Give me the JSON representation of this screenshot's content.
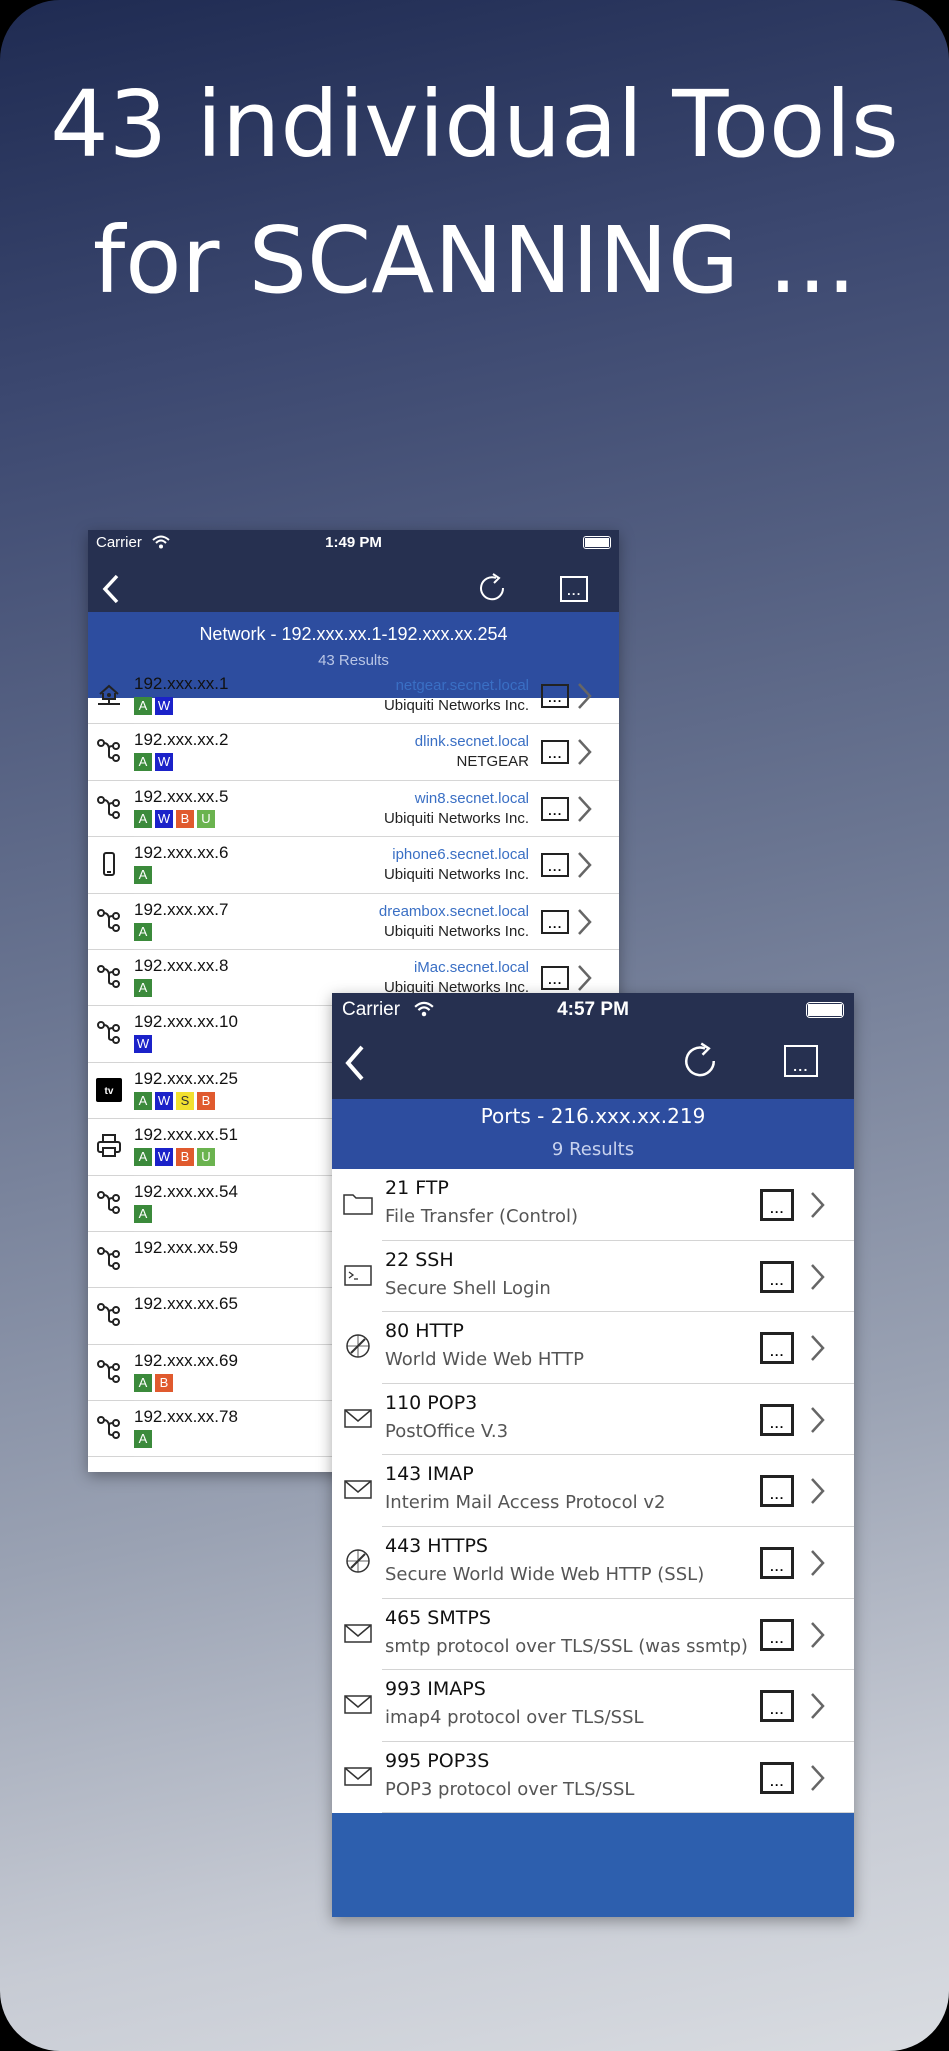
{
  "headline": {
    "line1": "43 individual Tools",
    "line2": "for SCANNING ..."
  },
  "network_screen": {
    "status": {
      "carrier": "Carrier",
      "time": "1:49 PM"
    },
    "banner": {
      "title": "Network - 192.xxx.xx.1-192.xxx.xx.254",
      "results": "43 Results"
    },
    "rows": [
      {
        "icon": "router-home-icon",
        "ip": "192.xxx.xx.1",
        "badges": [
          "A",
          "W"
        ],
        "host": "netgear.secnet.local",
        "vendor": "Ubiquiti Networks Inc."
      },
      {
        "icon": "network-node-icon",
        "ip": "192.xxx.xx.2",
        "badges": [
          "A",
          "W"
        ],
        "host": "dlink.secnet.local",
        "vendor": "NETGEAR"
      },
      {
        "icon": "network-node-icon",
        "ip": "192.xxx.xx.5",
        "badges": [
          "A",
          "W",
          "B",
          "U"
        ],
        "host": "win8.secnet.local",
        "vendor": "Ubiquiti Networks Inc."
      },
      {
        "icon": "phone-icon",
        "ip": "192.xxx.xx.6",
        "badges": [
          "A"
        ],
        "host": "iphone6.secnet.local",
        "vendor": "Ubiquiti Networks Inc."
      },
      {
        "icon": "network-node-icon",
        "ip": "192.xxx.xx.7",
        "badges": [
          "A"
        ],
        "host": "dreambox.secnet.local",
        "vendor": "Ubiquiti Networks Inc."
      },
      {
        "icon": "network-node-icon",
        "ip": "192.xxx.xx.8",
        "badges": [
          "A"
        ],
        "host": "iMac.secnet.local",
        "vendor": "Ubiquiti Networks Inc."
      },
      {
        "icon": "network-node-icon",
        "ip": "192.xxx.xx.10",
        "badges": [
          "W"
        ],
        "host": "",
        "vendor": ""
      },
      {
        "icon": "tv-icon",
        "ip": "192.xxx.xx.25",
        "badges": [
          "A",
          "W",
          "S",
          "B"
        ],
        "host": "",
        "vendor": ""
      },
      {
        "icon": "printer-icon",
        "ip": "192.xxx.xx.51",
        "badges": [
          "A",
          "W",
          "B",
          "U"
        ],
        "host": "",
        "vendor": ""
      },
      {
        "icon": "network-node-icon",
        "ip": "192.xxx.xx.54",
        "badges": [
          "A"
        ],
        "host": "",
        "vendor": ""
      },
      {
        "icon": "network-node-icon",
        "ip": "192.xxx.xx.59",
        "badges": [],
        "host": "",
        "vendor": ""
      },
      {
        "icon": "network-node-icon",
        "ip": "192.xxx.xx.65",
        "badges": [],
        "host": "",
        "vendor": ""
      },
      {
        "icon": "network-node-icon",
        "ip": "192.xxx.xx.69",
        "badges": [
          "A",
          "B"
        ],
        "host": "",
        "vendor": ""
      },
      {
        "icon": "network-node-icon",
        "ip": "192.xxx.xx.78",
        "badges": [
          "A"
        ],
        "host": "",
        "vendor": ""
      }
    ]
  },
  "ports_screen": {
    "status": {
      "carrier": "Carrier",
      "time": "4:57 PM"
    },
    "banner": {
      "title": "Ports - 216.xxx.xx.219",
      "results": "9 Results"
    },
    "rows": [
      {
        "icon": "folder-icon",
        "port": "21 FTP",
        "desc": "File Transfer (Control)"
      },
      {
        "icon": "terminal-icon",
        "port": "22 SSH",
        "desc": "Secure Shell Login"
      },
      {
        "icon": "compass-icon",
        "port": "80 HTTP",
        "desc": "World Wide Web HTTP"
      },
      {
        "icon": "mail-icon",
        "port": "110 POP3",
        "desc": "PostOffice V.3"
      },
      {
        "icon": "mail-icon",
        "port": "143 IMAP",
        "desc": "Interim Mail Access Protocol v2"
      },
      {
        "icon": "compass-icon",
        "port": "443 HTTPS",
        "desc": "Secure World Wide Web HTTP (SSL)"
      },
      {
        "icon": "mail-icon",
        "port": "465 SMTPS",
        "desc": "smtp protocol over TLS/SSL (was ssmtp)"
      },
      {
        "icon": "mail-icon",
        "port": "993 IMAPS",
        "desc": "imap4 protocol over TLS/SSL"
      },
      {
        "icon": "mail-icon",
        "port": "995 POP3S",
        "desc": "POP3 protocol over TLS/SSL"
      }
    ]
  },
  "colors": {
    "navbar": "#263050",
    "banner": "#2d4d9f",
    "link": "#3a6fc4",
    "badge_A": "#3b8a3b",
    "badge_W": "#1b22c9",
    "badge_B": "#e05a2e",
    "badge_U": "#6bb34f",
    "badge_S": "#f2e030"
  }
}
